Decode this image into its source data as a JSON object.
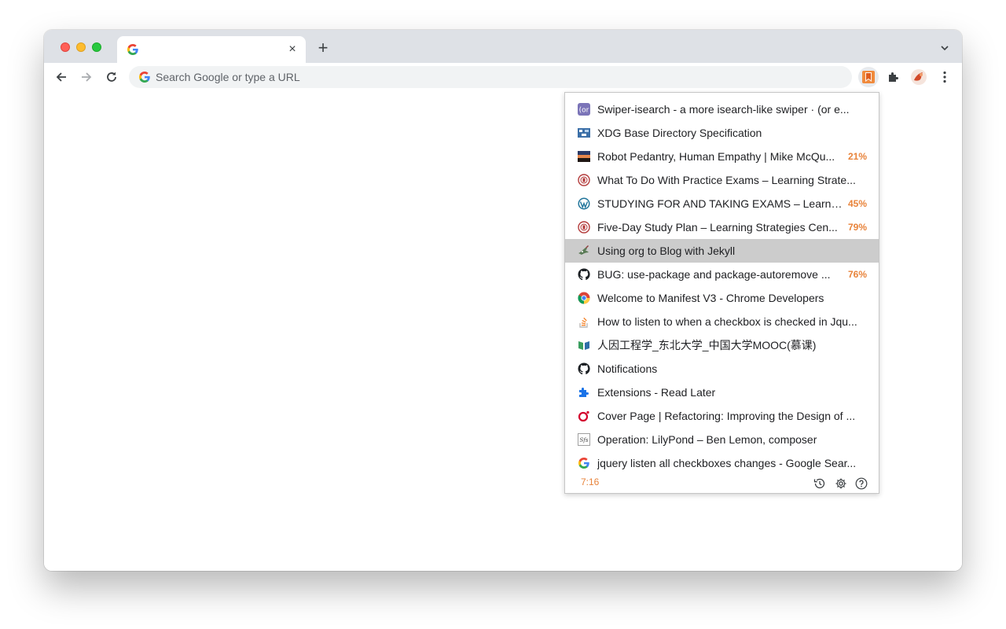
{
  "browser": {
    "tab_close_glyph": "×",
    "new_tab_glyph": "+",
    "omnibox_placeholder": "Search Google or type a URL"
  },
  "colors": {
    "accent_orange": "#e8833a",
    "selected_row": "#cccccc",
    "titlebar": "#dee1e6"
  },
  "popup": {
    "items": [
      {
        "icon": "orgmode-icon",
        "title": "Swiper-isearch - a more isearch-like swiper · (or e...",
        "pct": ""
      },
      {
        "icon": "xdg-icon",
        "title": "XDG Base Directory Specification",
        "pct": ""
      },
      {
        "icon": "sunset-thumbnail-icon",
        "title": "Robot Pedantry, Human Empathy | Mike McQu...",
        "pct": "21%"
      },
      {
        "icon": "university-seal-icon",
        "title": "What To Do With Practice Exams – Learning Strate...",
        "pct": ""
      },
      {
        "icon": "wordpress-icon",
        "title": "STUDYING FOR AND TAKING EXAMS – Learni...",
        "pct": "45%"
      },
      {
        "icon": "university-seal-icon",
        "title": "Five-Day Study Plan – Learning Strategies Cen...",
        "pct": "79%"
      },
      {
        "icon": "jekyll-icon",
        "title": "Using org to Blog with Jekyll",
        "pct": "",
        "selected": true
      },
      {
        "icon": "github-icon",
        "title": "BUG: use-package and package-autoremove ...",
        "pct": "76%"
      },
      {
        "icon": "chrome-icon",
        "title": "Welcome to Manifest V3 - Chrome Developers",
        "pct": ""
      },
      {
        "icon": "stackoverflow-icon",
        "title": "How to listen to when a checkbox is checked in Jqu...",
        "pct": ""
      },
      {
        "icon": "mooc-icon",
        "title": "人因工程学_东北大学_中国大学MOOC(慕课)",
        "pct": ""
      },
      {
        "icon": "github-icon",
        "title": "Notifications",
        "pct": ""
      },
      {
        "icon": "puzzle-icon",
        "title": "Extensions - Read Later",
        "pct": ""
      },
      {
        "icon": "oreilly-icon",
        "title": "Cover Page | Refactoring: Improving the Design of ...",
        "pct": ""
      },
      {
        "icon": "sfs-icon",
        "title": "Operation: LilyPond – Ben Lemon, composer",
        "pct": ""
      },
      {
        "icon": "google-icon",
        "title": "jquery listen all checkboxes changes - Google Sear...",
        "pct": ""
      }
    ],
    "footer": {
      "time": "7:16"
    }
  }
}
